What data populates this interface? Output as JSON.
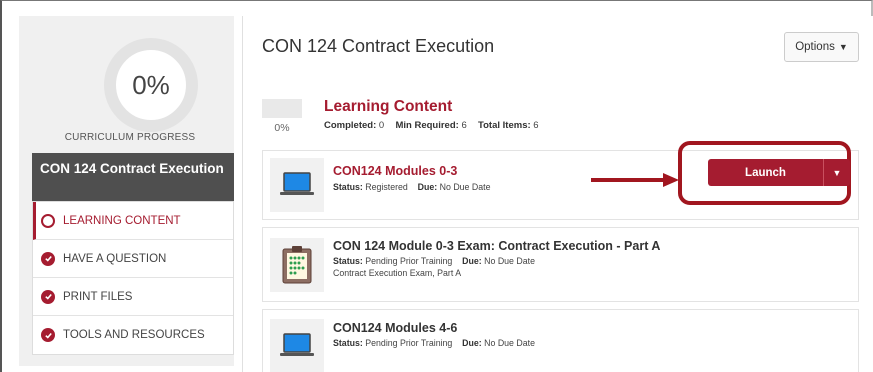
{
  "sidebar": {
    "progress_value": "0%",
    "progress_label": "CURRICULUM PROGRESS",
    "course_name": "CON 124 Contract Execution",
    "menu": [
      {
        "label": "LEARNING CONTENT",
        "icon": "circle-outline-icon",
        "active": true
      },
      {
        "label": "HAVE A QUESTION",
        "icon": "check-circle-icon",
        "active": false
      },
      {
        "label": "PRINT FILES",
        "icon": "check-circle-icon",
        "active": false
      },
      {
        "label": "TOOLS AND RESOURCES",
        "icon": "check-circle-icon",
        "active": false
      }
    ]
  },
  "header": {
    "title": "CON 124 Contract Execution",
    "options_label": "Options"
  },
  "learning_content": {
    "title": "Learning Content",
    "percent": "0%",
    "progress_fraction": 0,
    "completed_label": "Completed:",
    "completed_value": "0",
    "min_required_label": "Min Required:",
    "min_required_value": "6",
    "total_label": "Total Items:",
    "total_value": "6"
  },
  "items": [
    {
      "title": "CON124 Modules 0-3",
      "status_label": "Status:",
      "status": "Registered",
      "due_label": "Due:",
      "due": "No Due Date",
      "icon": "laptop-icon",
      "action": "Launch"
    },
    {
      "title": "CON 124 Module 0-3 Exam: Contract Execution - Part A",
      "status_label": "Status:",
      "status": "Pending Prior Training",
      "due_label": "Due:",
      "due": "No Due Date",
      "description": "Contract Execution Exam, Part A",
      "icon": "clipboard-icon"
    },
    {
      "title": "CON124 Modules 4-6",
      "status_label": "Status:",
      "status": "Pending Prior Training",
      "due_label": "Due:",
      "due": "No Due Date",
      "icon": "laptop-icon"
    }
  ],
  "colors": {
    "accent": "#a51c30",
    "annotation": "#a1161f"
  }
}
